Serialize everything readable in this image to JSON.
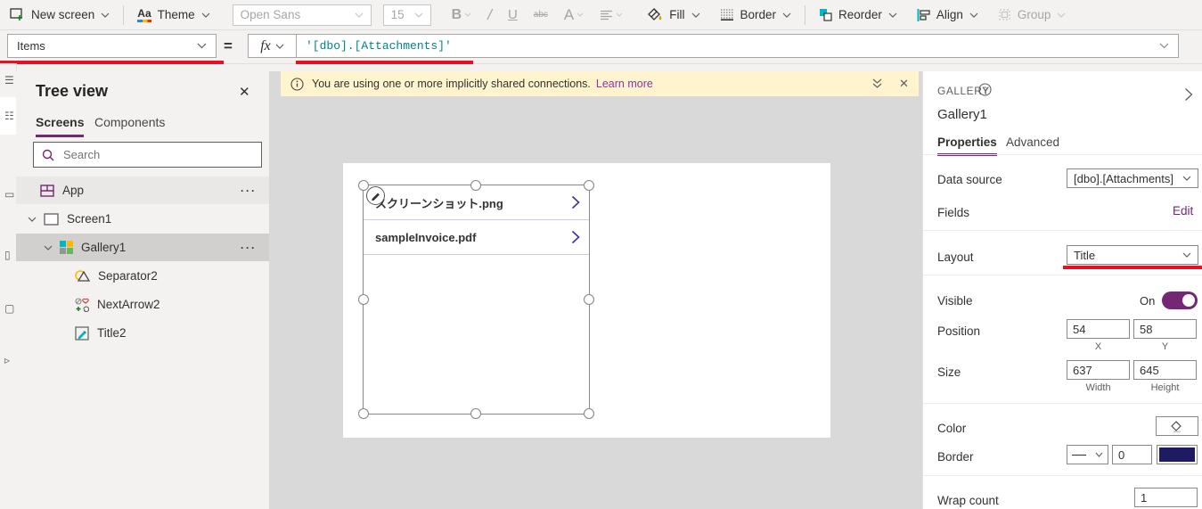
{
  "toolbar": {
    "new_screen": "New screen",
    "theme": "Theme",
    "font_family": "Open Sans",
    "font_size": "15",
    "bold": "B",
    "italic": "/",
    "underline": "U",
    "strikethrough": "abc",
    "font_color": "A",
    "fill": "Fill",
    "border": "Border",
    "reorder": "Reorder",
    "align": "Align",
    "group": "Group"
  },
  "formula_bar": {
    "property": "Items",
    "equals": "=",
    "fx": "fx",
    "formula": "'[dbo].[Attachments]'"
  },
  "tree": {
    "title": "Tree view",
    "tabs": [
      "Screens",
      "Components"
    ],
    "search_placeholder": "Search",
    "items": [
      {
        "label": "App"
      },
      {
        "label": "Screen1"
      },
      {
        "label": "Gallery1"
      },
      {
        "label": "Separator2"
      },
      {
        "label": "NextArrow2"
      },
      {
        "label": "Title2"
      }
    ]
  },
  "banner": {
    "message": "You are using one or more implicitly shared connections.",
    "link": "Learn more"
  },
  "canvas": {
    "gallery_items": [
      {
        "title": "スクリーンショット.png"
      },
      {
        "title": "sampleInvoice.pdf"
      }
    ]
  },
  "properties_panel": {
    "control_type": "GALLERY",
    "control_name": "Gallery1",
    "tabs": [
      "Properties",
      "Advanced"
    ],
    "data_source_label": "Data source",
    "data_source_value": "[dbo].[Attachments]",
    "fields_label": "Fields",
    "fields_action": "Edit",
    "layout_label": "Layout",
    "layout_value": "Title",
    "visible_label": "Visible",
    "visible_state": "On",
    "position_label": "Position",
    "position_x": "54",
    "position_y": "58",
    "x_label": "X",
    "y_label": "Y",
    "size_label": "Size",
    "size_width": "637",
    "size_height": "645",
    "width_label": "Width",
    "height_label": "Height",
    "color_label": "Color",
    "border_label": "Border",
    "border_weight": "0",
    "wrap_count_label": "Wrap count",
    "wrap_count_value": "1"
  },
  "colors": {
    "accent_purple": "#742774",
    "annotation_red": "#e81123",
    "formula_teal": "#038387",
    "banner_yellow": "#fff4ce",
    "border_swatch_navy": "#1e1a63",
    "gallery_chevron_blue": "#3533a1"
  }
}
